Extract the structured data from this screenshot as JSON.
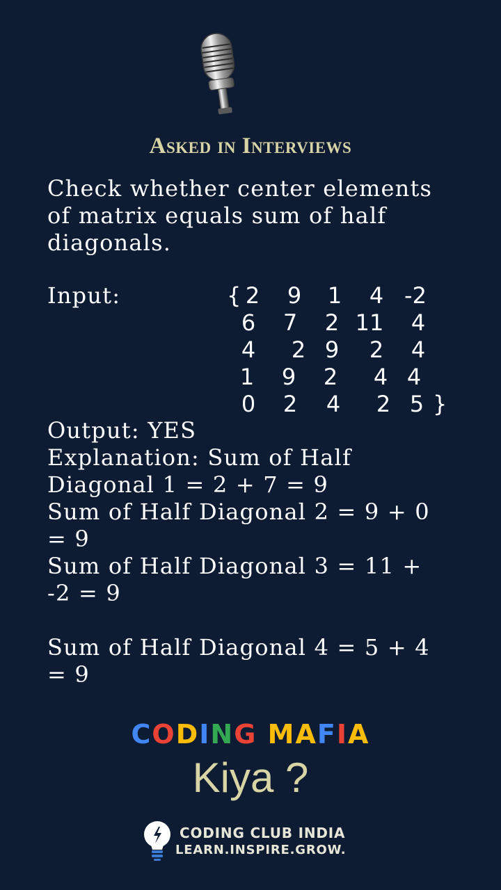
{
  "heading": "Asked in Interviews",
  "problem": "Check whether center elements\nof matrix equals sum of half\ndiagonals.",
  "input_label": "Input:",
  "matrix": {
    "open_brace": "{",
    "close_brace": "}",
    "rows": [
      [
        "2",
        "9",
        "1",
        "4",
        "-2"
      ],
      [
        "6",
        "7",
        "2",
        "11",
        "4"
      ],
      [
        "4",
        "2",
        "9",
        "2",
        "4"
      ],
      [
        "1",
        "9",
        "2",
        "4",
        "4"
      ],
      [
        "0",
        "2",
        "4",
        "2",
        "5"
      ]
    ]
  },
  "output_text": "Output: YES\nExplanation: Sum of Half\nDiagonal 1 = 2 + 7 = 9\nSum of Half Diagonal 2 = 9 + 0\n= 9\nSum of Half Diagonal 3 = 11 +\n-2 = 9\n\nSum of Half Diagonal 4 = 5 + 4\n= 9",
  "brand": {
    "letters": [
      {
        "char": "C",
        "color": "#4285f4"
      },
      {
        "char": "O",
        "color": "#ea4335"
      },
      {
        "char": "D",
        "color": "#fbbc05"
      },
      {
        "char": "I",
        "color": "#4285f4"
      },
      {
        "char": "N",
        "color": "#34a853"
      },
      {
        "char": "G",
        "color": "#ea4335"
      },
      {
        "char": " ",
        "color": "#ffffff"
      },
      {
        "char": "M",
        "color": "#fbbc05"
      },
      {
        "char": "A",
        "color": "#fbbc05"
      },
      {
        "char": "F",
        "color": "#4285f4"
      },
      {
        "char": "I",
        "color": "#ea4335"
      },
      {
        "char": "A",
        "color": "#fbbc05"
      }
    ]
  },
  "kiya": "Kiya ?",
  "footer": {
    "name": "CODING CLUB INDIA",
    "tagline": "LEARN.INSPIRE.GROW."
  },
  "colors": {
    "background": "#0d1b33",
    "heading": "#d9d4a5",
    "text": "#ffffff"
  },
  "icons": {
    "microphone": "microphone-icon",
    "bulb": "lightbulb-icon"
  }
}
